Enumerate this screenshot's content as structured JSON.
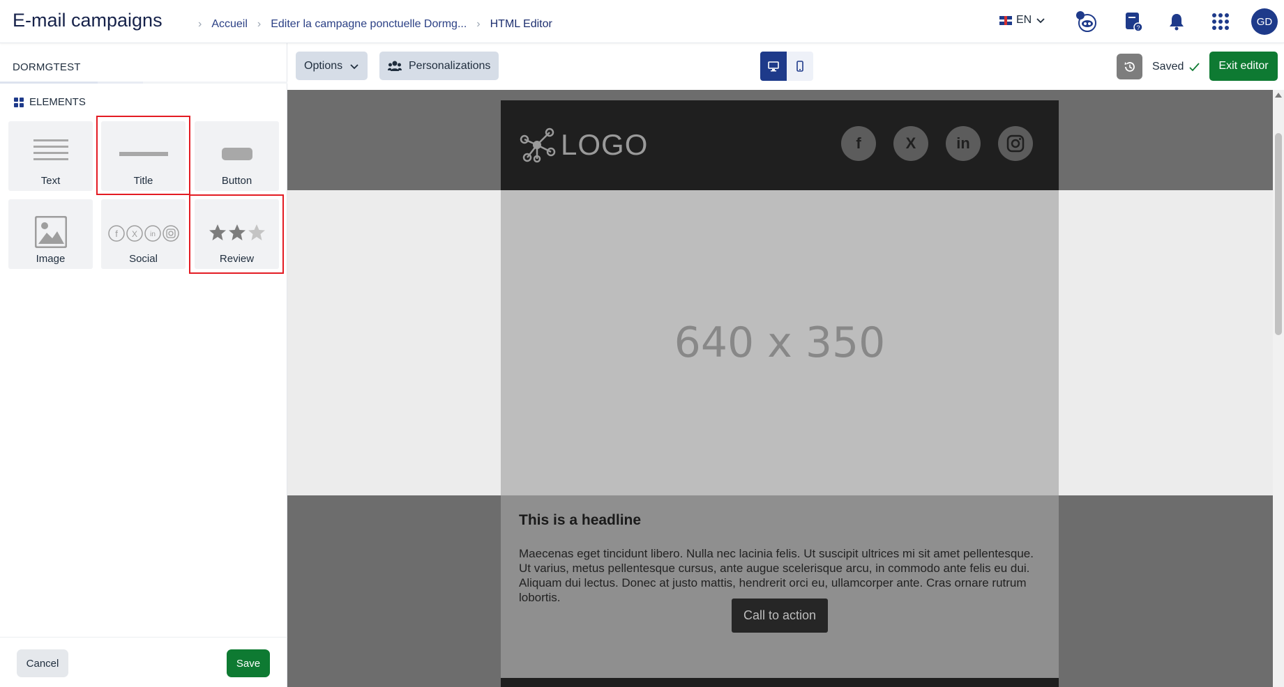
{
  "header": {
    "app_title": "E-mail campaigns",
    "breadcrumbs": [
      "Accueil",
      "Editer la campagne ponctuelle Dormg...",
      "HTML Editor"
    ],
    "language": "EN",
    "avatar_initials": "GD",
    "icons": [
      "flag-uk-icon",
      "chevron-down-icon",
      "assistant-icon",
      "help-doc-icon",
      "bell-icon",
      "apps-grid-icon"
    ]
  },
  "left_panel": {
    "campaign_name": "DORMGTEST",
    "elements_title": "ELEMENTS",
    "tiles": [
      {
        "label": "Text",
        "icon": "text-lines-icon",
        "highlighted": false
      },
      {
        "label": "Title",
        "icon": "title-bar-icon",
        "highlighted": true
      },
      {
        "label": "Button",
        "icon": "button-shape-icon",
        "highlighted": false
      },
      {
        "label": "Image",
        "icon": "image-icon",
        "highlighted": false
      },
      {
        "label": "Social",
        "icon": "social-icons-icon",
        "highlighted": false
      },
      {
        "label": "Review",
        "icon": "stars-icon",
        "highlighted": true
      }
    ],
    "cancel_label": "Cancel",
    "save_label": "Save"
  },
  "toolbar": {
    "options_label": "Options",
    "personalizations_label": "Personalizations",
    "device_modes": [
      "desktop",
      "mobile"
    ],
    "active_device": "desktop",
    "saved_label": "Saved",
    "exit_label": "Exit editor"
  },
  "email": {
    "logo_text": "LOGO",
    "social_letters": [
      "f",
      "X",
      "in",
      "ig"
    ],
    "hero_placeholder": "640 x 350",
    "headline": "This is a headline",
    "paragraph": "Maecenas eget tincidunt libero. Nulla nec lacinia felis. Ut suscipit ultrices mi sit amet pellentesque. Ut varius, metus pellentesque cursus, ante augue scelerisque arcu, in commodo ante felis eu dui. Aliquam dui lectus. Donec at justo mattis, hendrerit orci eu, ullamcorper ante. Cras ornare rutrum lobortis.",
    "cta_label": "Call to action"
  },
  "colors": {
    "brand_navy": "#1e3a8a",
    "save_green": "#0e7a32",
    "highlight_red": "#e31b23"
  }
}
